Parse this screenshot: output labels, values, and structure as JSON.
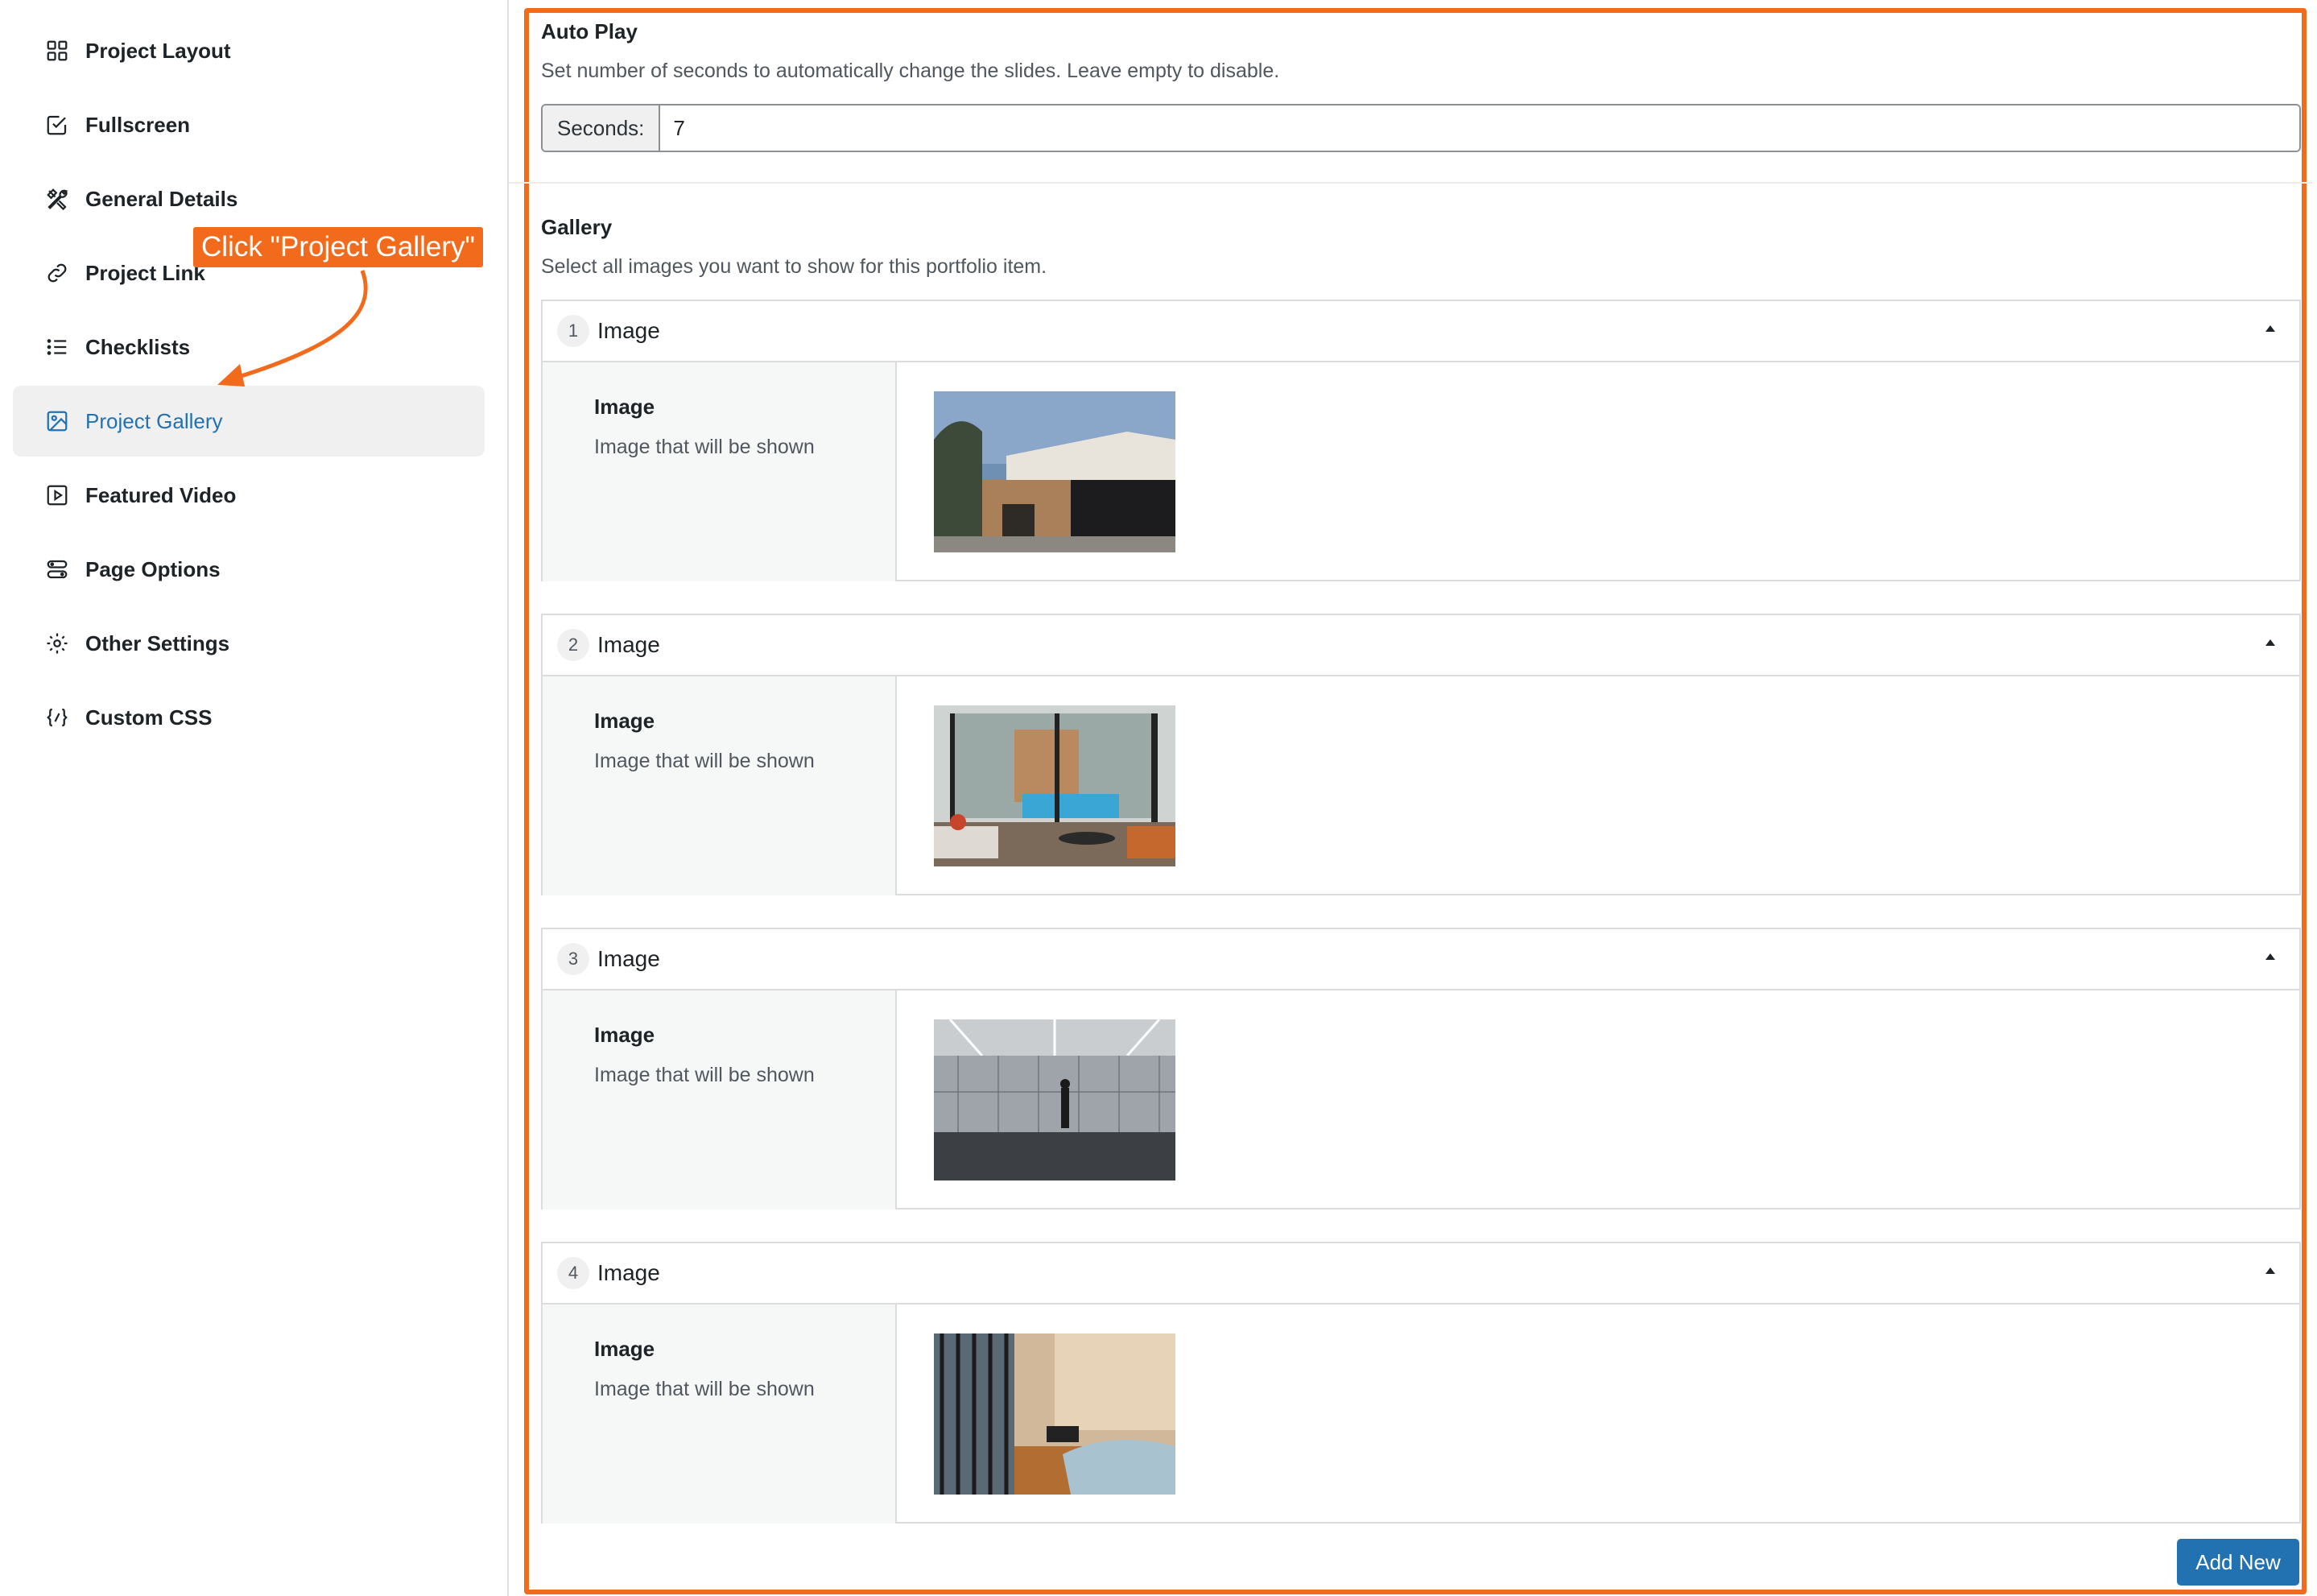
{
  "sidebar": {
    "items": [
      {
        "label": "Project Layout",
        "icon": "layout-grid-icon"
      },
      {
        "label": "Fullscreen",
        "icon": "checkbox-icon"
      },
      {
        "label": "General Details",
        "icon": "tools-icon"
      },
      {
        "label": "Project Link",
        "icon": "link-icon"
      },
      {
        "label": "Checklists",
        "icon": "list-icon"
      },
      {
        "label": "Project Gallery",
        "icon": "image-icon",
        "active": true
      },
      {
        "label": "Featured Video",
        "icon": "video-icon"
      },
      {
        "label": "Page Options",
        "icon": "options-icon"
      },
      {
        "label": "Other Settings",
        "icon": "gear-icon"
      },
      {
        "label": "Custom CSS",
        "icon": "code-icon"
      }
    ]
  },
  "callout": {
    "text": "Click \"Project Gallery\""
  },
  "autoplay": {
    "title": "Auto Play",
    "description": "Set number of seconds to automatically change the slides. Leave empty to disable.",
    "prefix": "Seconds:",
    "value": "7"
  },
  "gallery": {
    "title": "Gallery",
    "description": "Select all images you want to show for this portfolio item.",
    "items": [
      {
        "number": "1",
        "title": "Image",
        "field_label": "Image",
        "field_desc": "Image that will be shown",
        "thumb": "house-exterior"
      },
      {
        "number": "2",
        "title": "Image",
        "field_label": "Image",
        "field_desc": "Image that will be shown",
        "thumb": "living-room-pool"
      },
      {
        "number": "3",
        "title": "Image",
        "field_label": "Image",
        "field_desc": "Image that will be shown",
        "thumb": "gallery-hall"
      },
      {
        "number": "4",
        "title": "Image",
        "field_label": "Image",
        "field_desc": "Image that will be shown",
        "thumb": "bedroom"
      }
    ],
    "add_new_label": "Add New"
  },
  "colors": {
    "accent": "#f26b1d",
    "primary": "#2271b1"
  }
}
